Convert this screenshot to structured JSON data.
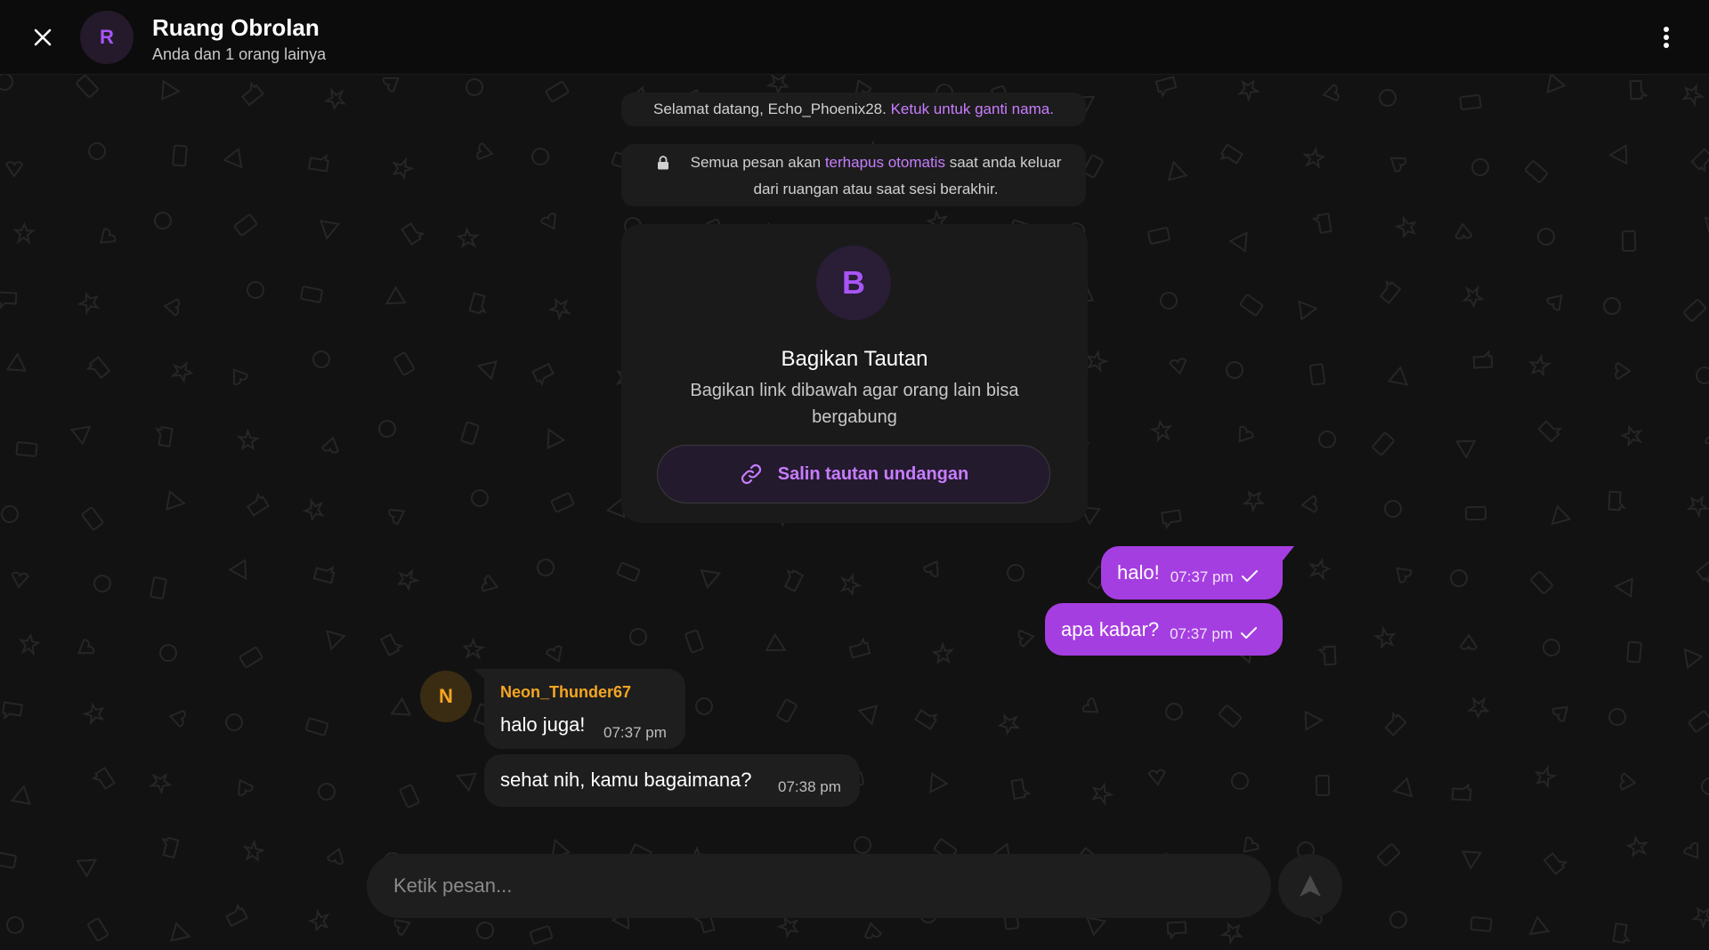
{
  "header": {
    "close_icon": "close-icon",
    "avatar_letter": "R",
    "title": "Ruang Obrolan",
    "subtitle": "Anda dan 1 orang lainya",
    "menu_icon": "more-vertical-icon"
  },
  "system": {
    "welcome_text": "Selamat datang, Echo_Phoenix28.",
    "welcome_link": "Ketuk untuk ganti nama.",
    "notice_before": "Semua pesan akan ",
    "notice_highlight": "terhapus otomatis",
    "notice_after": " saat anda keluar dari ruangan atau saat sesi berakhir.",
    "lock_icon": "lock-icon"
  },
  "invite": {
    "avatar_letter": "B",
    "title": "Bagikan Tautan",
    "description": "Bagikan link dibawah agar orang lain bisa bergabung",
    "button_label": "Salin tautan undangan",
    "button_icon": "link-icon"
  },
  "messages": {
    "outgoing": [
      {
        "text": "halo!",
        "time": "07:37 pm",
        "status_icon": "check-icon"
      },
      {
        "text": "apa kabar?",
        "time": "07:37 pm",
        "status_icon": "check-icon"
      }
    ],
    "incoming": {
      "sender": "Neon_Thunder67",
      "avatar_letter": "N",
      "items": [
        {
          "text": "halo juga!",
          "time": "07:37 pm"
        },
        {
          "text": "sehat nih, kamu bagaimana?",
          "time": "07:38 pm"
        }
      ]
    }
  },
  "composer": {
    "placeholder": "Ketik pesan...",
    "value": "",
    "send_icon": "send-icon"
  },
  "colors": {
    "background": "#121212",
    "accent": "#a855f7",
    "outgoing_bubble": "#a53ee0",
    "incoming_bubble": "#1e1e1e",
    "sender_name": "#f5a623"
  }
}
